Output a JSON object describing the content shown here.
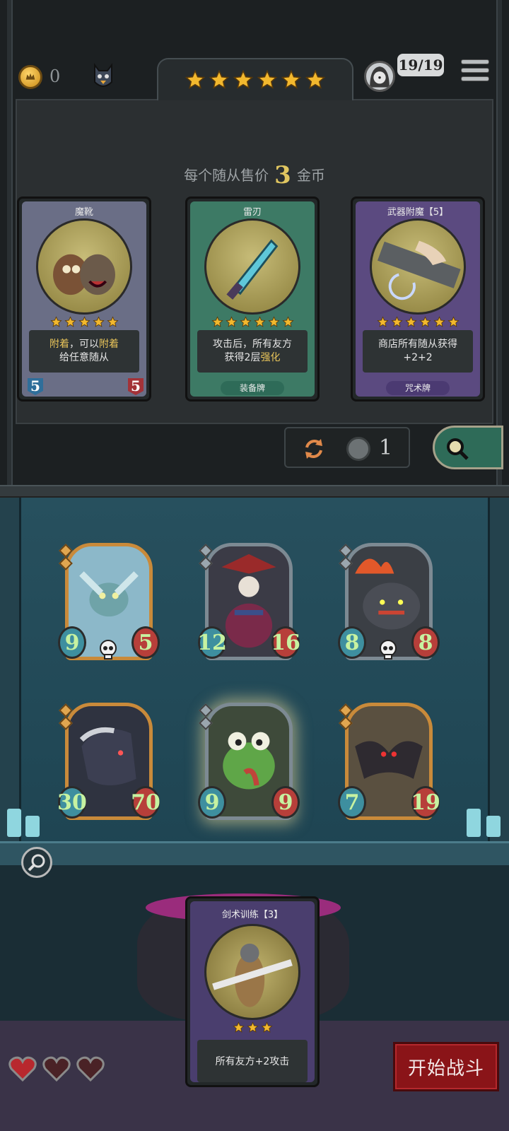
{
  "header": {
    "coins": "0",
    "rank_stars": 6,
    "hp": "19/19"
  },
  "shop": {
    "price_prefix": "每个随从售价",
    "price_value": "3",
    "price_suffix": "金币",
    "cards": [
      {
        "title": "魔靴",
        "stars": 5,
        "desc_parts": [
          "附着",
          "，可以",
          "附着",
          "给任意随从"
        ],
        "atk": "5",
        "hp": "5",
        "tag": ""
      },
      {
        "title": "雷刃",
        "stars": 6,
        "desc_line1": "攻击后，所有友方",
        "desc_line2_prefix": "获得2层",
        "desc_line2_hl": "强化",
        "tag": "装备牌"
      },
      {
        "title": "武器附魔【5】",
        "stars": 6,
        "desc": "商店所有随从获得+2+2",
        "tag": "咒术牌"
      }
    ],
    "refresh_cost": "1"
  },
  "board": {
    "minions": [
      {
        "atk": "9",
        "hp": "5",
        "deathrattle": true,
        "tier_frame": "gold"
      },
      {
        "atk": "12",
        "hp": "16",
        "deathrattle": false,
        "tier_frame": "silver"
      },
      {
        "atk": "8",
        "hp": "8",
        "deathrattle": true,
        "tier_frame": "silver"
      },
      {
        "atk": "30",
        "hp": "70",
        "deathrattle": false,
        "tier_frame": "gold"
      },
      {
        "atk": "9",
        "hp": "9",
        "deathrattle": false,
        "tier_frame": "silver"
      },
      {
        "atk": "7",
        "hp": "19",
        "deathrattle": false,
        "tier_frame": "gold"
      }
    ]
  },
  "hand": {
    "title": "剑术训练【3】",
    "stars": 3,
    "desc": "所有友方+2攻击"
  },
  "lives": 3,
  "start_button": "开始战斗",
  "colors": {
    "gold_text": "#e0c660",
    "stat_text": "#c7f2a1",
    "start_red": "#8a1418"
  }
}
